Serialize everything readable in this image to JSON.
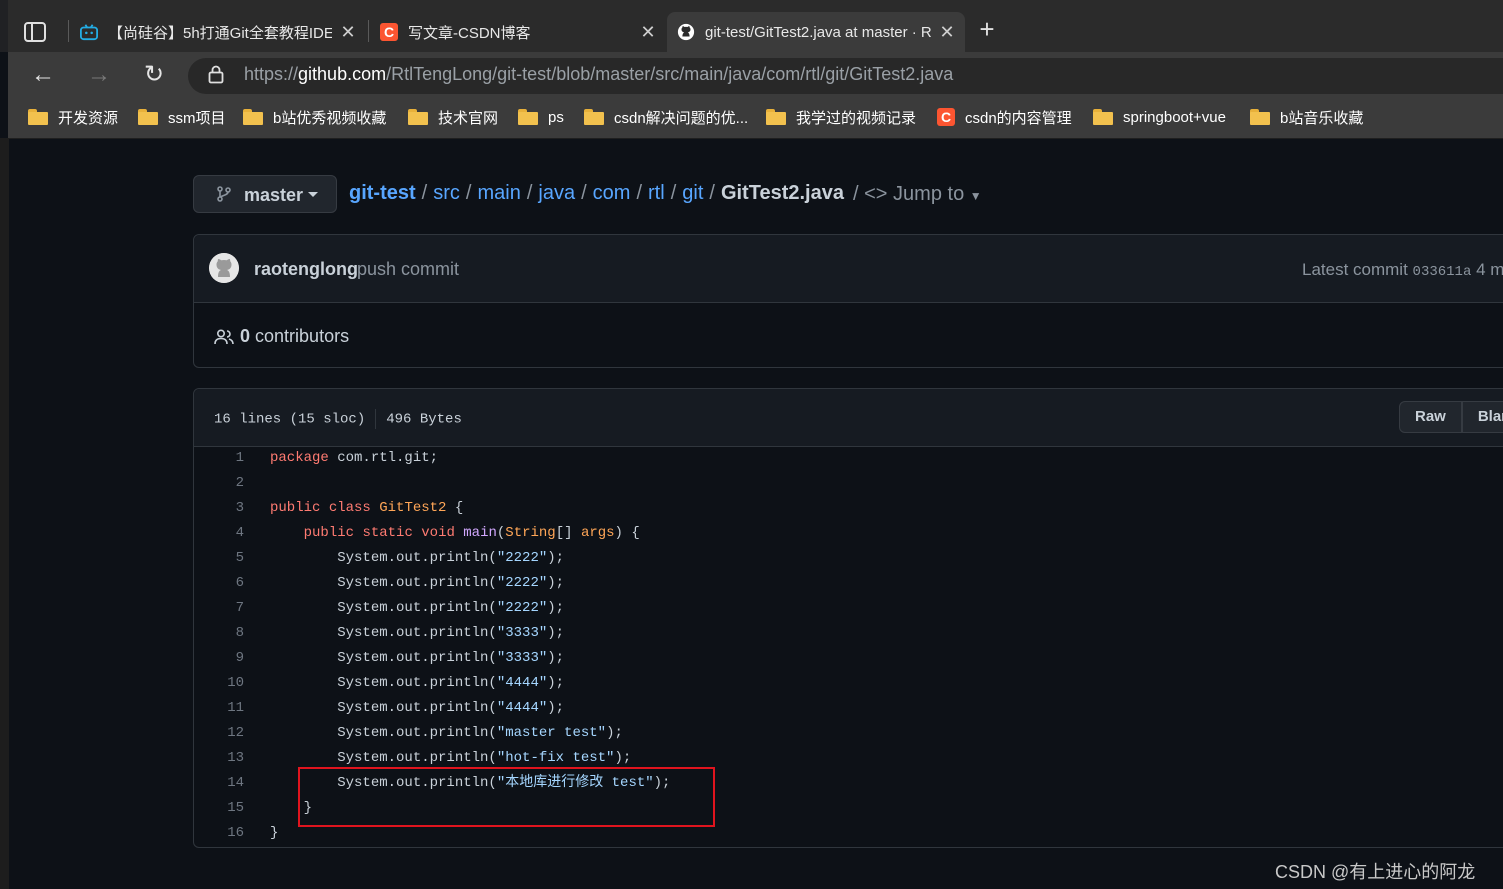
{
  "browser": {
    "tabs": [
      {
        "title": "【尚硅谷】5h打通Git全套教程IDE",
        "icon": "bilibili-icon",
        "active": false
      },
      {
        "title": "写文章-CSDN博客",
        "icon": "csdn-icon",
        "active": false
      },
      {
        "title": "git-test/GitTest2.java at master · R",
        "icon": "github-icon",
        "active": true
      }
    ],
    "url_prefix": "https://",
    "url_host": "github.com",
    "url_path": "/RtlTengLong/git-test/blob/master/src/main/java/com/rtl/git/GitTest2.java",
    "bookmarks": [
      {
        "label": "开发资源",
        "icon": "folder-icon"
      },
      {
        "label": "ssm项目",
        "icon": "folder-icon"
      },
      {
        "label": "b站优秀视频收藏",
        "icon": "folder-icon"
      },
      {
        "label": "技术官网",
        "icon": "folder-icon"
      },
      {
        "label": "ps",
        "icon": "folder-icon"
      },
      {
        "label": "csdn解决问题的优...",
        "icon": "folder-icon"
      },
      {
        "label": "我学过的视频记录",
        "icon": "folder-icon"
      },
      {
        "label": "csdn的内容管理",
        "icon": "csdn-icon"
      },
      {
        "label": "springboot+vue",
        "icon": "folder-icon"
      },
      {
        "label": "b站音乐收藏",
        "icon": "folder-icon"
      }
    ]
  },
  "repo": {
    "branch": "master",
    "breadcrumb": [
      "git-test",
      "src",
      "main",
      "java",
      "com",
      "rtl",
      "git"
    ],
    "file_name": "GitTest2.java",
    "jump_to": "Jump to"
  },
  "commit": {
    "author": "raotenglong",
    "message": "push commit",
    "latest_label": "Latest commit",
    "hash": "033611a",
    "age": "4 m",
    "contributors_count": "0",
    "contributors_label": "contributors"
  },
  "file": {
    "lines_info": "16 lines (15 sloc)",
    "size": "496 Bytes",
    "raw_label": "Raw",
    "blame_label": "Blam",
    "code_lines": [
      "package com.rtl.git;",
      "",
      "public class GitTest2 {",
      "    public static void main(String[] args) {",
      "        System.out.println(\"2222\");",
      "        System.out.println(\"2222\");",
      "        System.out.println(\"2222\");",
      "        System.out.println(\"3333\");",
      "        System.out.println(\"3333\");",
      "        System.out.println(\"4444\");",
      "        System.out.println(\"4444\");",
      "        System.out.println(\"master test\");",
      "        System.out.println(\"hot-fix test\");",
      "        System.out.println(\"本地库进行修改 test\");",
      "    }",
      "}"
    ]
  },
  "watermark": "CSDN @有上进心的阿龙",
  "colors": {
    "highlight_box": "#e0141e",
    "link": "#58a6ff",
    "background": "#0d1117"
  }
}
